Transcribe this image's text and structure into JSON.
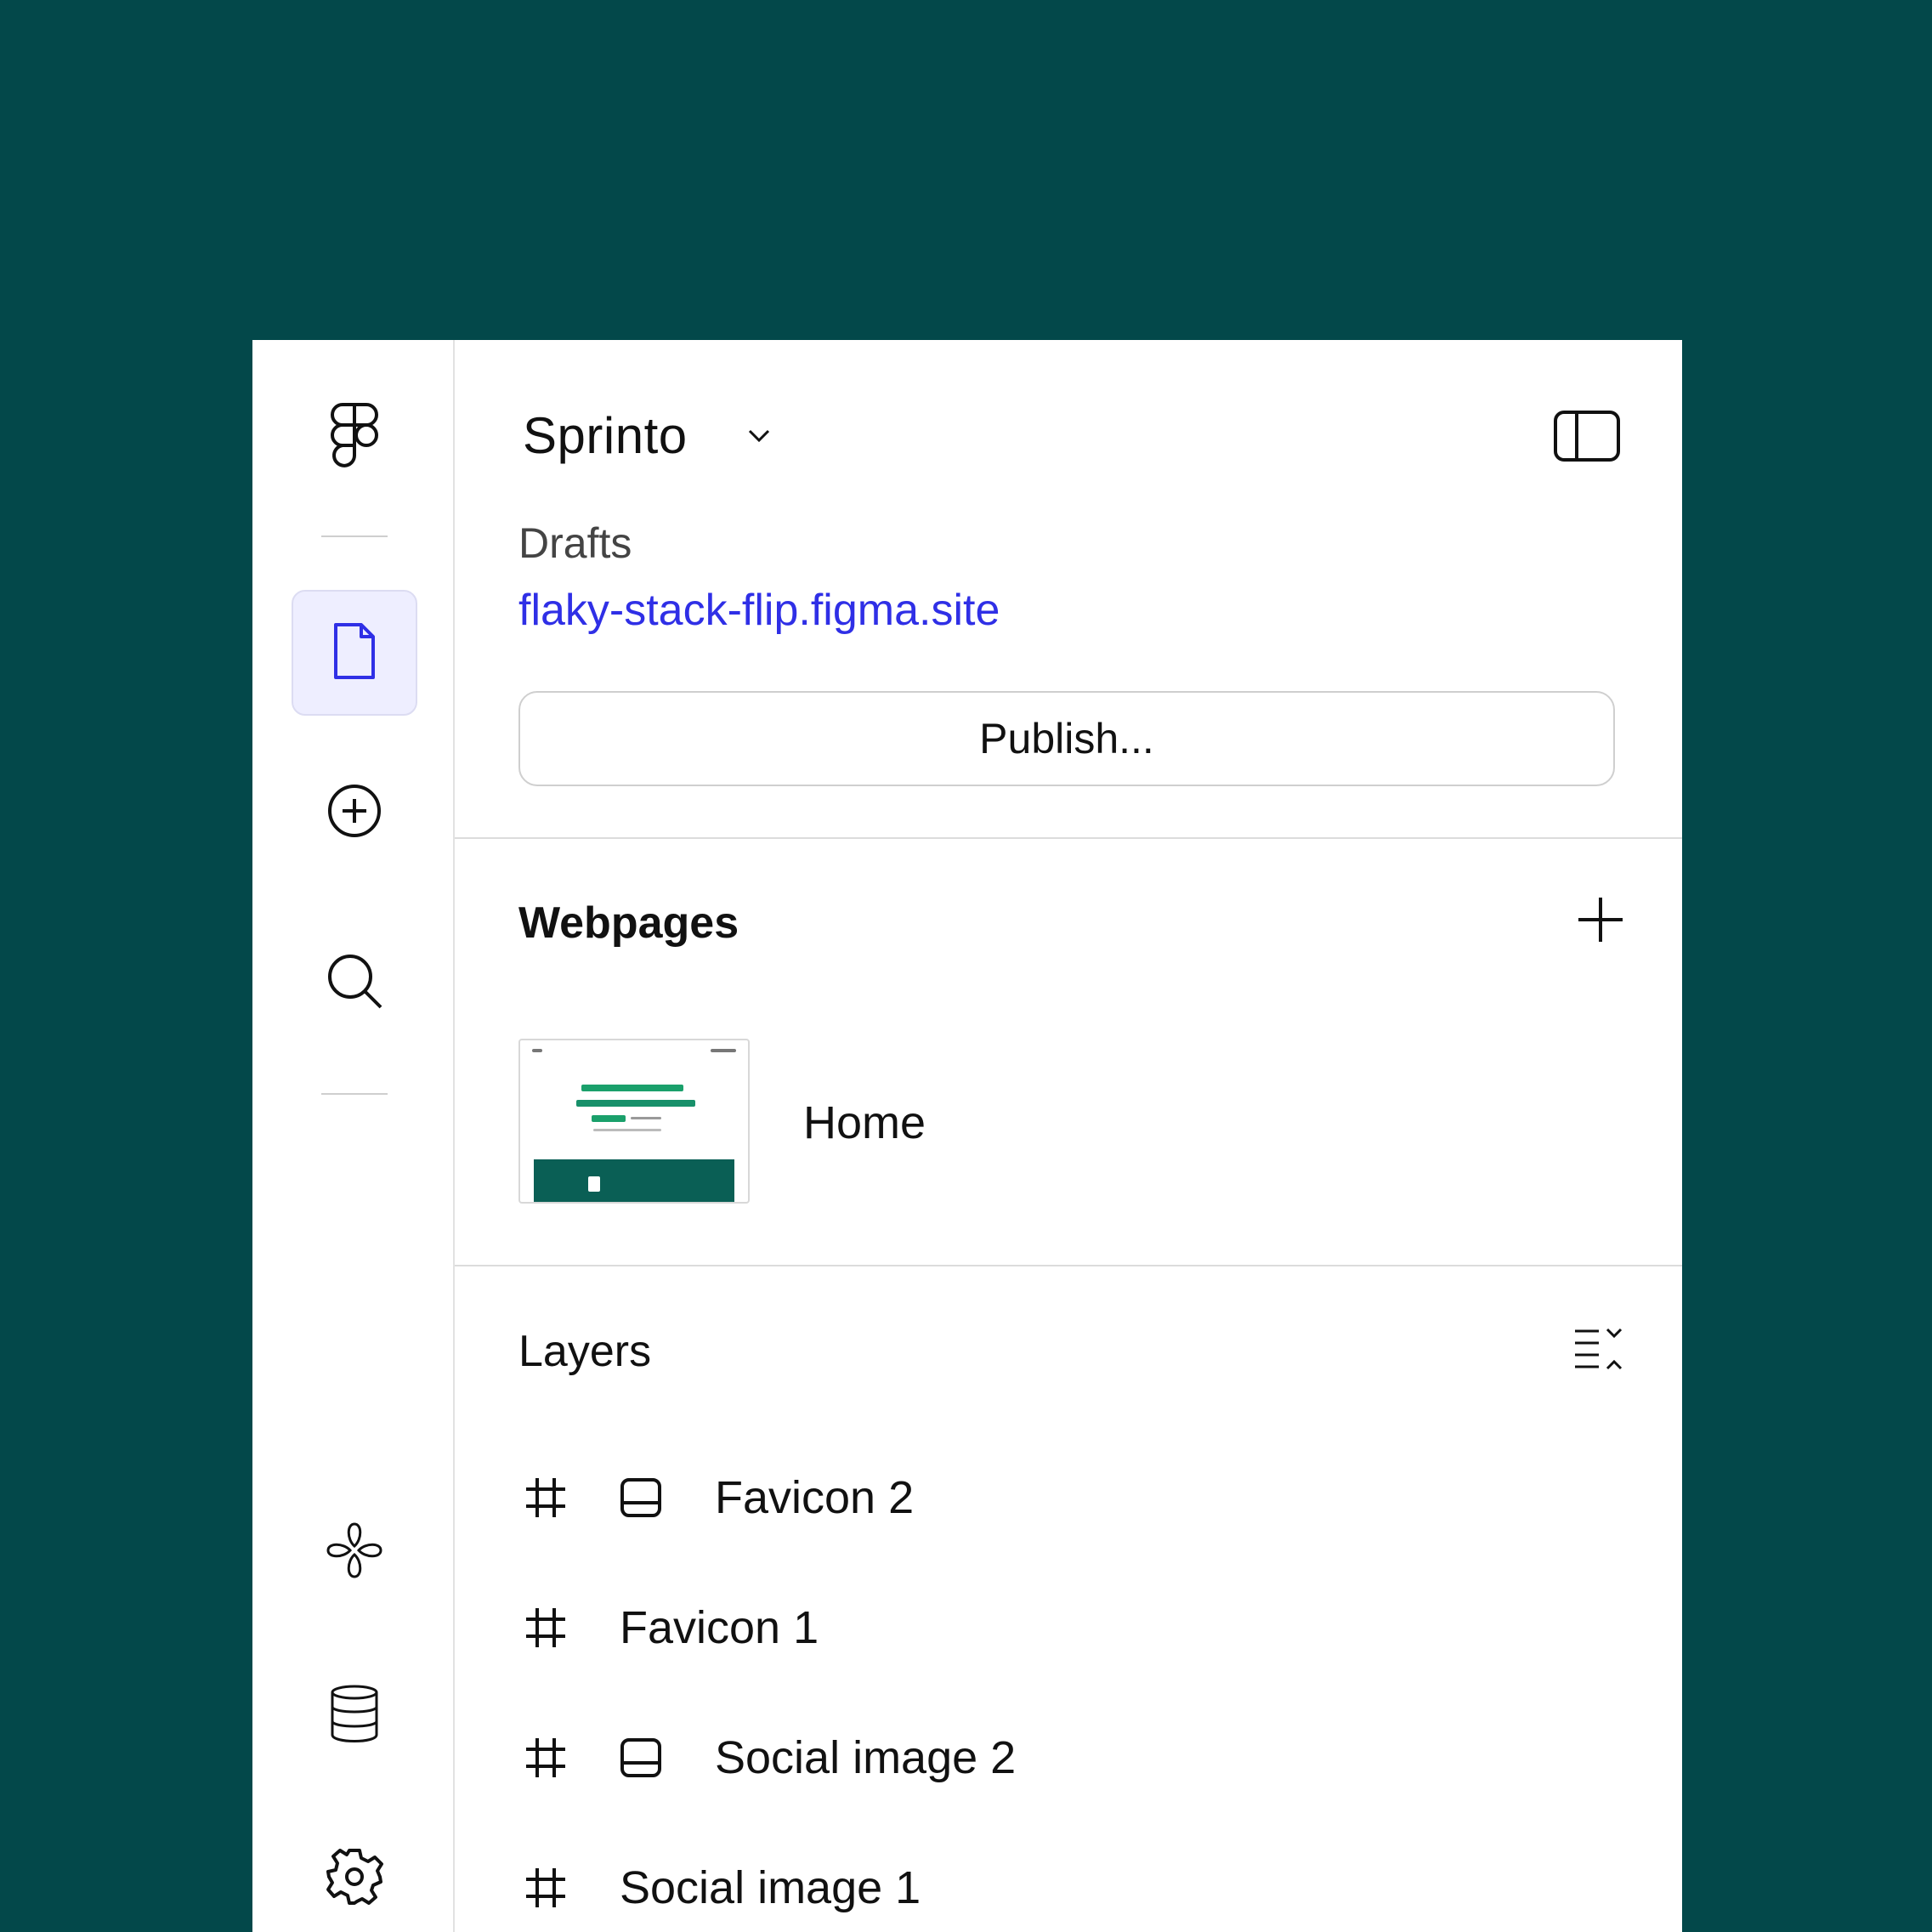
{
  "header": {
    "site_name": "Sprinto",
    "status": "Drafts",
    "site_url": "flaky-stack-flip.figma.site",
    "publish_label": "Publish..."
  },
  "rail": {
    "items": [
      {
        "icon": "figma-logo-icon"
      },
      {
        "icon": "page-icon",
        "active": true
      },
      {
        "icon": "add-circle-icon"
      },
      {
        "icon": "search-icon"
      },
      {
        "icon": "plugin-icon"
      },
      {
        "icon": "database-icon"
      },
      {
        "icon": "gear-icon"
      }
    ]
  },
  "webpages": {
    "title": "Webpages",
    "pages": [
      {
        "name": "Home"
      }
    ]
  },
  "layers": {
    "title": "Layers",
    "items": [
      {
        "name": "Favicon 2",
        "component": true
      },
      {
        "name": "Favicon 1",
        "component": false
      },
      {
        "name": "Social image 2",
        "component": true
      },
      {
        "name": "Social image 1",
        "component": false
      }
    ]
  },
  "colors": {
    "background": "#03484A",
    "link": "#2F2FE6",
    "active_rail": "#EEEEFF",
    "thumbnail_bar": "#0A5F55"
  }
}
